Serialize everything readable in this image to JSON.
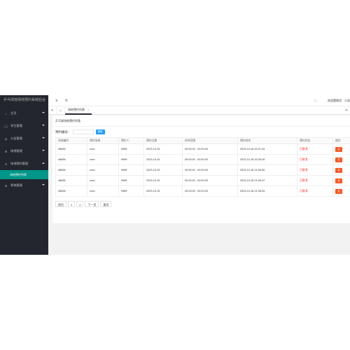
{
  "app": {
    "title": "乒乓球馆场地预约系统后台"
  },
  "sidebar": {
    "items": [
      {
        "label": "主页",
        "icon": "home-icon"
      },
      {
        "label": "学生管理",
        "icon": "user-icon"
      },
      {
        "label": "公告管理",
        "icon": "notice-icon"
      },
      {
        "label": "场地管理",
        "icon": "venue-icon"
      },
      {
        "label": "场地预约管理",
        "icon": "calendar-icon",
        "open": true
      },
      {
        "label": "系统管理",
        "icon": "settings-icon"
      }
    ],
    "sub_active": "场地预约列表"
  },
  "topbar": {
    "user_text": "欢迎管理员：小吴"
  },
  "tabs": [
    {
      "label": "场地预约列表",
      "close": "×"
    }
  ],
  "page": {
    "card_title": "乒乓球场地预约列表",
    "search_label": "预约编号：",
    "search_button": "搜索",
    "columns": [
      "场地编号",
      "预约场地",
      "预约人",
      "预约日期",
      "时间范围",
      "预约时间",
      "预约状态",
      "操作"
    ],
    "rows": [
      [
        "48656",
        "ccsx",
        "9989",
        "2023-10-15",
        "00:00:00 - 00:00:00",
        "2023-10-18 20:21:44",
        "已取消",
        "查"
      ],
      [
        "48656",
        "ccsx",
        "9989",
        "2023-10-15",
        "00:00:00 - 00:00:00",
        "2023-10-18 20:25:16",
        "已取消",
        "查"
      ],
      [
        "48656",
        "ccsx",
        "9989",
        "2023-10-15",
        "00:00:00 - 00:00:00",
        "2023-10-18 21:05:36",
        "已取消",
        "查"
      ],
      [
        "48656",
        "ccsx",
        "9989",
        "2023-10-15",
        "00:00:00 - 00:00:00",
        "2023-10-18 21:05:47",
        "已取消",
        "查"
      ],
      [
        "48656",
        "ccsx",
        "9989",
        "2023-10-15",
        "00:00:00 - 00:00:00",
        "2023-10-18 21:06:05",
        "已取消",
        "查"
      ]
    ],
    "pager": [
      "首页",
      "1",
      "2",
      "下一页",
      "尾页"
    ]
  },
  "colors": {
    "sidebar_bg": "#23262e",
    "accent": "#009688",
    "search_btn": "#1e9fff",
    "status_red": "#ff2020",
    "op_btn": "#ff5722"
  }
}
